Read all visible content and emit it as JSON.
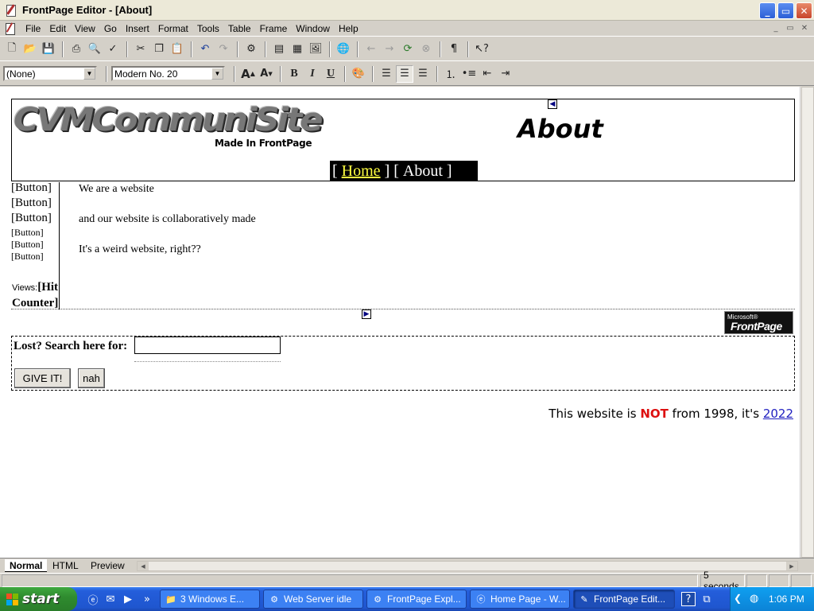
{
  "window": {
    "title": "FrontPage Editor - [About]",
    "controls": {
      "minimize": "_",
      "maximize": "▭",
      "close": "✕"
    }
  },
  "menubar": {
    "items": [
      "File",
      "Edit",
      "View",
      "Go",
      "Insert",
      "Format",
      "Tools",
      "Table",
      "Frame",
      "Window",
      "Help"
    ],
    "mdi_controls": [
      "_",
      "▭",
      "✕"
    ]
  },
  "toolbar_standard": {
    "icons": [
      "new-page-icon",
      "open-icon",
      "save-icon",
      "print-icon",
      "print-preview-icon",
      "spelling-icon",
      "cut-icon",
      "copy-icon",
      "paste-icon",
      "undo-icon",
      "redo-icon",
      "webbot-icon",
      "insert-form-field-icon",
      "insert-table-icon",
      "insert-image-icon",
      "hyperlink-icon",
      "back-icon",
      "forward-icon",
      "refresh-icon",
      "stop-icon",
      "show-paragraph-marks-icon",
      "help-icon"
    ]
  },
  "toolbar_format": {
    "style_value": "(None)",
    "font_value": "Modern No. 20",
    "bold": "B",
    "italic": "I",
    "underline": "U"
  },
  "page": {
    "logo_text": "CVMCommuniSite",
    "made_in_text": "Made In FrontPage",
    "heading": "About",
    "nav": {
      "open1": "[ ",
      "home": "Home",
      "mid": " ] [ ",
      "about": "About",
      "close": " ]"
    },
    "sidebar_buttons": [
      "[Button]",
      "[Button]",
      "[Button]",
      "[Button]",
      "[Button]",
      "[Button]"
    ],
    "views_label": "Views:",
    "hit_counter": "[Hit Counter]",
    "body_lines": [
      "We are a website",
      "and our website is collaboratively made",
      "It's a weird website, right??"
    ],
    "badge": {
      "small": "Microsoft®",
      "big": "FrontPage"
    },
    "search": {
      "label": "Lost? Search here for:",
      "value": "",
      "submit_label": "GIVE IT!",
      "reset_label": "nah"
    },
    "footer": {
      "prefix": "This website is ",
      "not": "NOT",
      "middle": " from 1998, it's ",
      "year": "2022"
    }
  },
  "view_tabs": [
    "Normal",
    "HTML",
    "Preview"
  ],
  "active_view_tab": "Normal",
  "status": {
    "load_time": "5 seconds"
  },
  "taskbar": {
    "start_label": "start",
    "buttons": [
      {
        "label": "3 Windows E...",
        "count": "3"
      },
      {
        "label": "Web Server idle"
      },
      {
        "label": "FrontPage Expl..."
      },
      {
        "label": "Home Page - W..."
      },
      {
        "label": "FrontPage Edit..."
      }
    ],
    "clock": "1:06 PM"
  },
  "colors": {
    "titlebar_bg": "#ece9d8",
    "taskbar_blue": "#245edb",
    "start_green": "#2f8c2f",
    "nav_bg": "#000000",
    "nav_home": "#ffff40",
    "footer_not": "#dd1010",
    "footer_link": "#2020c0"
  }
}
